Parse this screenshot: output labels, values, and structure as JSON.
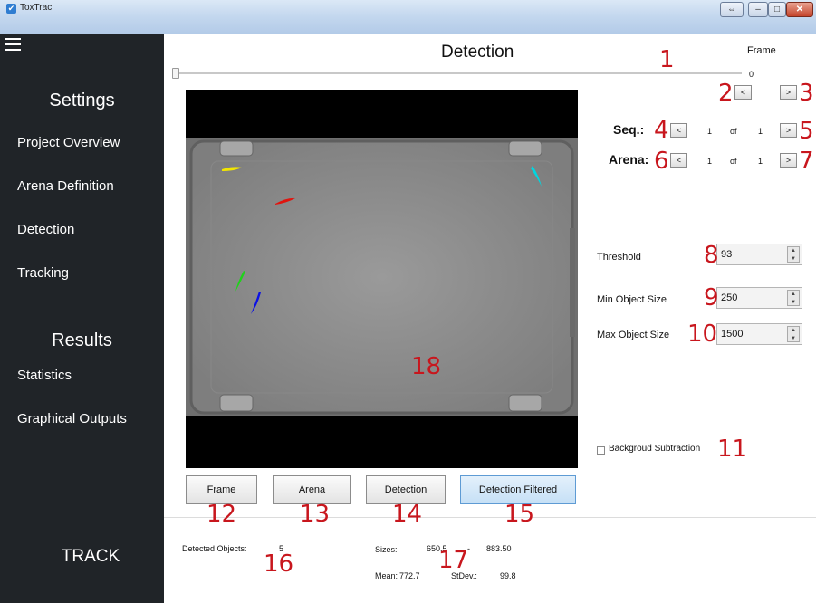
{
  "window": {
    "title": "ToxTrac",
    "app_icon": "toxtrac-logo-icon",
    "controls": [
      "restore-icon",
      "minimize-icon",
      "maximize-icon",
      "close-icon"
    ]
  },
  "sidebar": {
    "settings_header": "Settings",
    "settings_items": [
      "Project Overview",
      "Arena Definition",
      "Detection",
      "Tracking"
    ],
    "results_header": "Results",
    "results_items": [
      "Statistics",
      "Graphical Outputs"
    ],
    "track_label": "TRACK"
  },
  "header": {
    "title": "Detection",
    "frame_label": "Frame",
    "frame_value": "0",
    "prev_label": "<",
    "next_label": ">"
  },
  "sequence": {
    "label": "Seq.:",
    "prev_label": "<",
    "current": "1",
    "of_label": "of",
    "total": "1",
    "next_label": ">"
  },
  "arena_nav": {
    "label": "Arena:",
    "prev_label": "<",
    "current": "1",
    "of_label": "of",
    "total": "1",
    "next_label": ">"
  },
  "parameters": {
    "threshold_label": "Threshold",
    "threshold_value": "93",
    "min_size_label": "Min Object Size",
    "min_size_value": "250",
    "max_size_label": "Max Object Size",
    "max_size_value": "1500",
    "bg_subtraction_label": "Backgroud Subtraction",
    "bg_subtraction_checked": false
  },
  "view_buttons": {
    "frame": "Frame",
    "arena": "Arena",
    "detection": "Detection",
    "detection_filtered": "Detection Filtered"
  },
  "stats": {
    "detected_label": "Detected Objects:",
    "detected_value": "5",
    "sizes_label": "Sizes:",
    "size_min": "650.5",
    "size_sep": "-",
    "size_max": "883.50",
    "mean_label": "Mean:",
    "mean_value": "772.7",
    "stdev_label": "StDev.:",
    "stdev_value": "99.8"
  },
  "annotations": [
    "1",
    "2",
    "3",
    "4",
    "5",
    "6",
    "7",
    "8",
    "9",
    "10",
    "11",
    "12",
    "13",
    "14",
    "15",
    "16",
    "17",
    "18"
  ],
  "colors": {
    "sidebar_bg": "#202428",
    "annotation_red": "#c8161d",
    "active_button": "#c6e0f6",
    "fish": [
      "#f2e600",
      "#e0150f",
      "#00d6e0",
      "#1fd21a",
      "#0a10e6"
    ]
  }
}
